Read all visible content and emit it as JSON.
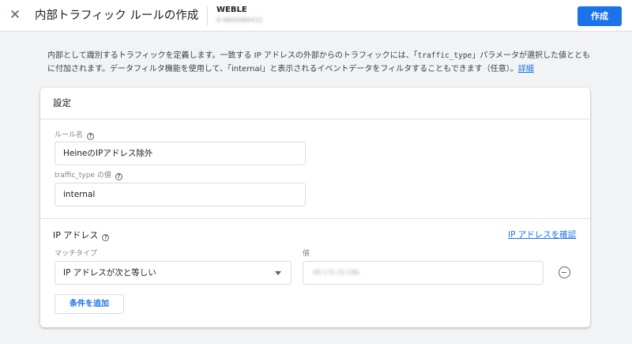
{
  "header": {
    "close_icon": "close-icon",
    "close_glyph": "✕",
    "title": "内部トラフィック ルールの作成",
    "account_name": "WEBLE",
    "account_id": "0-9699989432",
    "create_label": "作成",
    "accent_color": "#1a73e8"
  },
  "description": {
    "text_1": "内部として識別するトラフィックを定義します。一致する IP アドレスの外部からのトラフィックには、「",
    "code": "traffic_type",
    "text_2": "」パラメータが選択した値とともに付加されます。データフィルタ機能を使用して、「internal」と表示されるイベントデータをフィルタすることもできます（任意）。",
    "link": "詳細"
  },
  "settings": {
    "title": "設定",
    "rule_name": {
      "label": "ルール名",
      "value": "HeineのIPアドレス除外"
    },
    "traffic_type": {
      "label": "traffic_type の値",
      "value": "internal"
    },
    "help_icon": "help-circle-icon",
    "help_glyph": "?",
    "ip_section": {
      "title": "IP アドレス",
      "confirm_link": "IP アドレスを確認",
      "match_type_label": "マッチタイプ",
      "match_type_value": "IP アドレスが次と等しい",
      "value_label": "値",
      "value": "49.172.25.186",
      "remove_icon": "remove-circle-icon",
      "add_condition_label": "条件を追加"
    }
  }
}
